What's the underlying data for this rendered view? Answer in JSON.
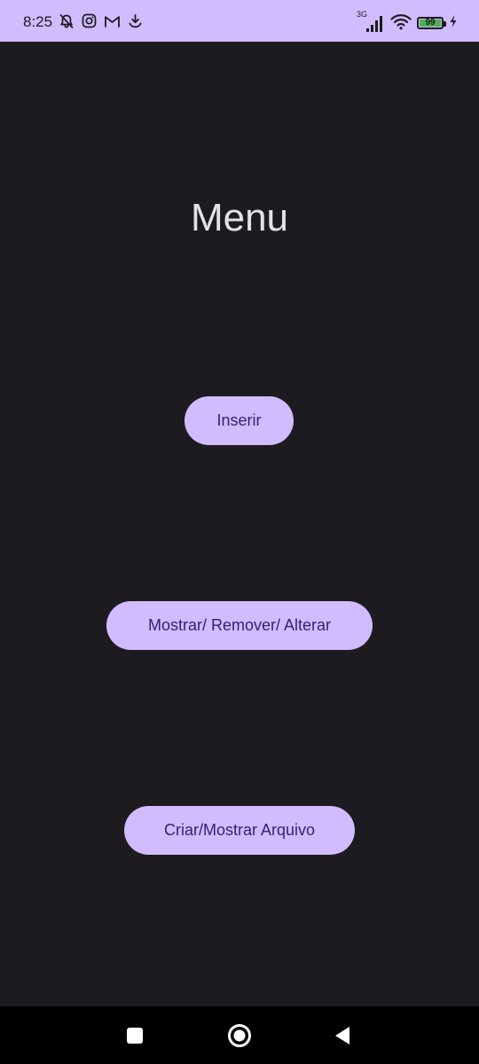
{
  "status_bar": {
    "time": "8:25",
    "network_type": "3G",
    "battery_level": "99",
    "battery_fraction": 0.99,
    "background_color": "#d0bcff",
    "left_icons": [
      "notifications-off-icon",
      "instagram-icon",
      "gmail-icon",
      "download-icon"
    ],
    "right_icons": [
      "signal-icon",
      "wifi-icon",
      "battery-icon",
      "charging-bolt-icon"
    ]
  },
  "screen": {
    "title": "Menu",
    "background_color": "#1d1b20",
    "buttons": {
      "inserir": "Inserir",
      "mostrar_remover_alterar": "Mostrar/ Remover/ Alterar",
      "criar_mostrar_arquivo": "Criar/Mostrar Arquivo"
    },
    "button_color": "#d0bcff",
    "button_text_color": "#381e72"
  },
  "nav_bar": {
    "icons": [
      "recents-square-icon",
      "home-circle-icon",
      "back-triangle-icon"
    ]
  }
}
